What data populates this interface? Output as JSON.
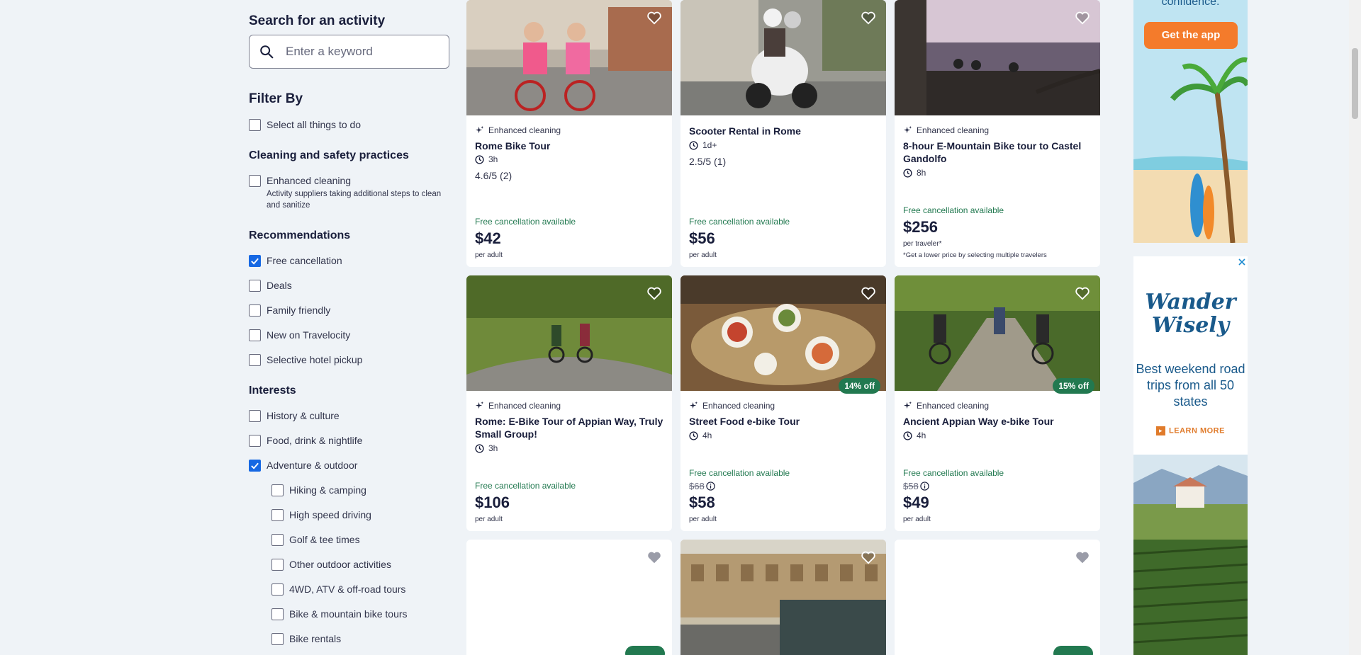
{
  "search": {
    "title": "Search for an activity",
    "placeholder": "Enter a keyword",
    "value": ""
  },
  "filters": {
    "title": "Filter By",
    "select_all": {
      "label": "Select all things to do",
      "checked": false
    },
    "cleaning": {
      "title": "Cleaning and safety practices",
      "option": {
        "label": "Enhanced cleaning",
        "checked": false
      },
      "description": "Activity suppliers taking additional steps to clean and sanitize"
    },
    "recommendations": {
      "title": "Recommendations",
      "options": [
        {
          "label": "Free cancellation",
          "checked": true
        },
        {
          "label": "Deals",
          "checked": false
        },
        {
          "label": "Family friendly",
          "checked": false
        },
        {
          "label": "New on Travelocity",
          "checked": false
        },
        {
          "label": "Selective hotel pickup",
          "checked": false
        }
      ]
    },
    "interests": {
      "title": "Interests",
      "options": [
        {
          "label": "History & culture",
          "checked": false
        },
        {
          "label": "Food, drink & nightlife",
          "checked": false
        },
        {
          "label": "Adventure & outdoor",
          "checked": true
        }
      ],
      "sub_options": [
        {
          "label": "Hiking & camping",
          "checked": false
        },
        {
          "label": "High speed driving",
          "checked": false
        },
        {
          "label": "Golf & tee times",
          "checked": false
        },
        {
          "label": "Other outdoor activities",
          "checked": false
        },
        {
          "label": "4WD, ATV & off-road tours",
          "checked": false
        },
        {
          "label": "Bike & mountain bike tours",
          "checked": false
        },
        {
          "label": "Bike rentals",
          "checked": false
        }
      ]
    }
  },
  "cards": [
    {
      "cleaning": "Enhanced cleaning",
      "title": "Rome Bike Tour",
      "duration": "3h",
      "rating": "4.6/5",
      "reviews": "(2)",
      "free_cancel": "Free cancellation available",
      "price": "$42",
      "per": "per adult"
    },
    {
      "cleaning": "",
      "title": "Scooter Rental in Rome",
      "duration": "1d+",
      "rating": "2.5/5",
      "reviews": "(1)",
      "free_cancel": "Free cancellation available",
      "price": "$56",
      "per": "per adult"
    },
    {
      "cleaning": "Enhanced cleaning",
      "title": "8-hour E-Mountain Bike tour to Castel Gandolfo",
      "duration": "8h",
      "free_cancel": "Free cancellation available",
      "price": "$256",
      "per": "per traveler*",
      "note": "*Get a lower price by selecting multiple travelers"
    },
    {
      "cleaning": "Enhanced cleaning",
      "title": "Rome: E-Bike Tour of Appian Way, Truly Small Group!",
      "duration": "3h",
      "free_cancel": "Free cancellation available",
      "price": "$106",
      "per": "per adult"
    },
    {
      "cleaning": "Enhanced cleaning",
      "title": "Street Food e-bike Tour",
      "duration": "4h",
      "free_cancel": "Free cancellation available",
      "old_price": "$68",
      "price": "$58",
      "per": "per adult",
      "badge": "14% off"
    },
    {
      "cleaning": "Enhanced cleaning",
      "title": "Ancient Appian Way e-bike Tour",
      "duration": "4h",
      "free_cancel": "Free cancellation available",
      "old_price": "$58",
      "price": "$49",
      "per": "per adult",
      "badge": "15% off"
    }
  ],
  "ads": {
    "app": {
      "partial_text": "confidence.",
      "button": "Get the app"
    },
    "wander": {
      "brand_line1": "Wander",
      "brand_line2": "Wisely",
      "copy": "Best weekend road trips from all 50 states",
      "cta": "LEARN MORE"
    }
  },
  "colors": {
    "accent": "#1668e3",
    "success": "#227950",
    "orange": "#f47b2b",
    "ad_blue": "#1a5a8b"
  }
}
